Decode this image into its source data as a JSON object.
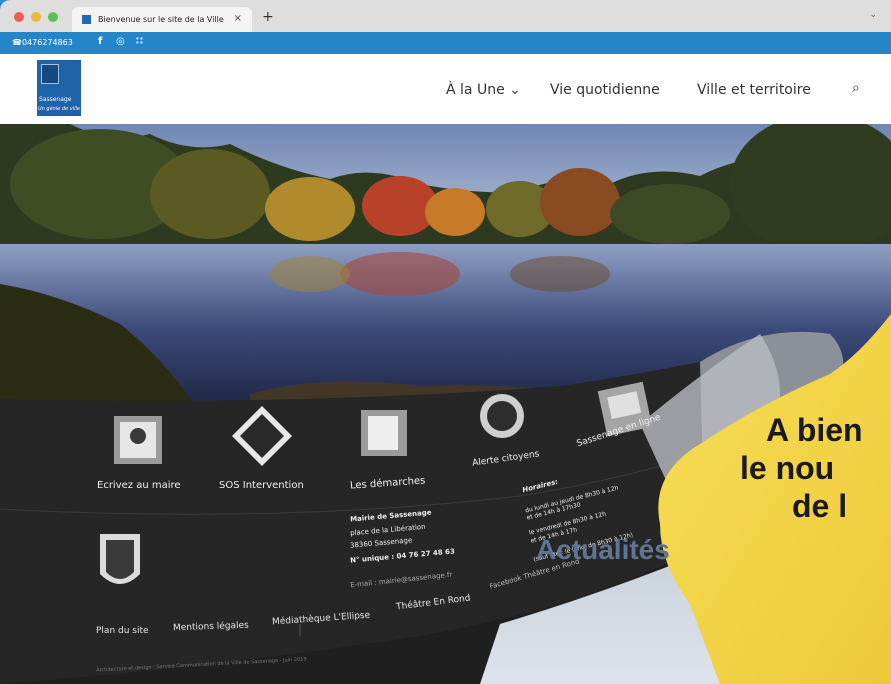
{
  "browser": {
    "tab_title": "Bienvenue sur le site de la Ville",
    "tab_close": "×",
    "new_tab": "+",
    "tabs_menu": "⌄"
  },
  "topbar": {
    "phone": "☎0476274863",
    "social": [
      "f",
      "◎",
      "∷"
    ]
  },
  "header": {
    "logo_name": "Sassenage",
    "logo_script": "Un génie de ville",
    "nav": [
      "À la Une ⌄",
      "Vie quotidienne",
      "Ville et territoire"
    ],
    "search_icon": "⌕"
  },
  "quick_links": [
    {
      "label": "Ecrivez au maire",
      "icon": "mail-user-icon"
    },
    {
      "label": "SOS Intervention",
      "icon": "roadwork-sign-icon"
    },
    {
      "label": "Les démarches",
      "icon": "documents-icon"
    },
    {
      "label": "Alerte citoyens",
      "icon": "alert-phone-icon"
    },
    {
      "label": "Sassenage en ligne",
      "icon": "online-screen-icon"
    }
  ],
  "footer": {
    "mairie_title": "Mairie de Sassenage",
    "mairie_lines": [
      "place de la Libération",
      "38360 Sassenage",
      "N° unique : 04 76 27 48 63"
    ],
    "email": "E-mail : mairie@sassenage.fr",
    "horaires_title": "Horaires:",
    "horaires_lines": [
      "du lundi au jeudi de 8h30 à 12h",
      "et de 14h à 17h30",
      "le vendredi de 8h30 à 12h",
      "et de 14h à 17h",
      "(sauf été : le lundi de 8h30 à 12h)"
    ],
    "social_links": "Facebook  Théâtre en Rond",
    "links": [
      "Plan du site",
      "Mentions légales",
      "Médiathèque L'Ellipse",
      "Théâtre En Rond"
    ],
    "credits": "Architecture et design : Service Communication de la Ville de Sassenage - Juin 2019"
  },
  "banner": {
    "line1": "A bien",
    "line2_prefix": "le ",
    "line2_bold": "nou",
    "line3": "de l"
  },
  "news_heading": "Actualités",
  "colors": {
    "accent_blue": "#2585c9",
    "banner_yellow": "#f5d94a",
    "panel_dark": "#262626"
  }
}
